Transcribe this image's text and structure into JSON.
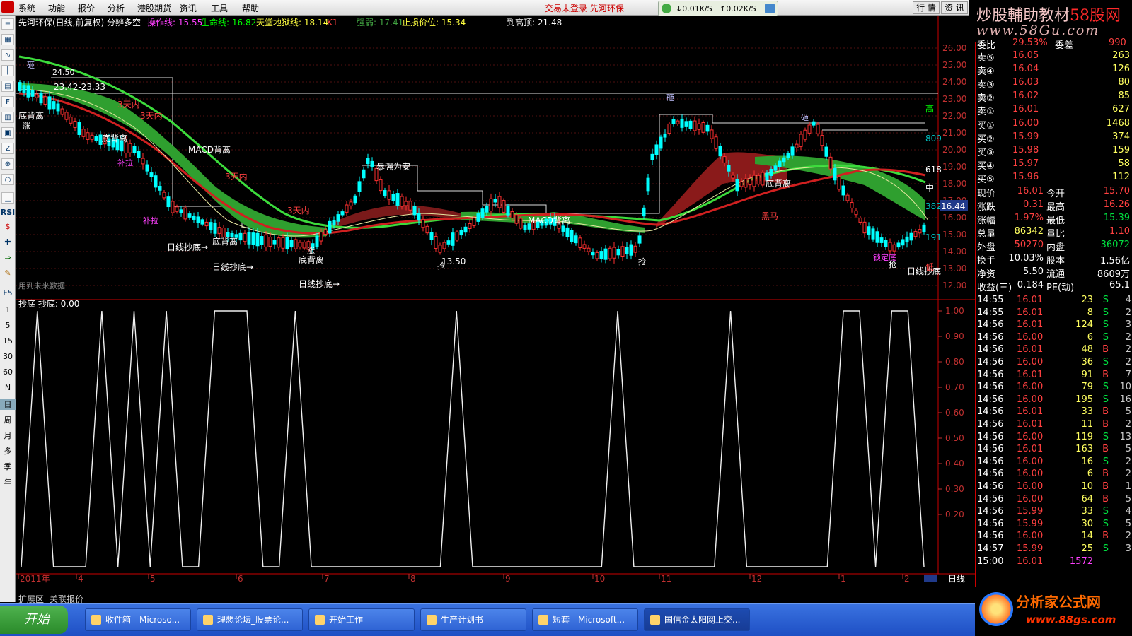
{
  "menu": [
    "系统",
    "功能",
    "报价",
    "分析",
    "港股期货",
    "资讯",
    "工具",
    "帮助"
  ],
  "status_msg": "交易未登录 先河环保",
  "net": {
    "down": "↓0.01K/S",
    "up": "↑0.02K/S"
  },
  "right_tabs": [
    "行 情",
    "资 讯"
  ],
  "brand": {
    "line1_a": "炒股輔助教材",
    "line1_b": "58股网",
    "line2": "www.58Gu.com"
  },
  "left_toolbar": {
    "icons": [
      "list-icon",
      "grid-icon",
      "line-icon",
      "kline-icon",
      "table-icon",
      "fio-icon",
      "chart-icon",
      "doc-icon",
      "fiz-icon",
      "zoom-icon",
      "search-icon",
      "bar-icon"
    ],
    "labels": [
      "RSI",
      "$",
      "✚",
      "⇒",
      "✎",
      "F5"
    ],
    "periods": [
      "1",
      "5",
      "15",
      "30",
      "60",
      "N",
      "日",
      "周",
      "月",
      "多",
      "季",
      "年"
    ]
  },
  "chart_header": {
    "title": "先河环保(日线,前复权) 分辨多空",
    "op_line": "操作线: 15.55",
    "life_line": "生命线: 16.82",
    "heaven_line": "天堂地狱线: 18.14",
    "k1": "K1 -",
    "strength": "强弱: 17.41",
    "stop_loss": "止损价位: 15.34",
    "to_top": "到高顶: 21.48"
  },
  "price_axis": [
    "26.00",
    "25.00",
    "24.00",
    "23.00",
    "22.00",
    "21.00",
    "20.00",
    "19.00",
    "18.00",
    "17.00",
    "16.00",
    "15.00",
    "14.00",
    "13.00",
    "12.00"
  ],
  "price_tags": {
    "current": "16.44",
    "high_mark": "高",
    "mid_mark": "中",
    "low_mark": "低",
    "r809": "809",
    "r618": "618",
    "r382": "382",
    "r191": "191"
  },
  "annotations": {
    "high_price": "24.50",
    "time_range": "23.42-23.33",
    "low_price": "13.50",
    "future_data": "用到未来数据",
    "bottom_div": "底背离",
    "macd_div": "MACD背离",
    "day_bottom": "日线抄底→",
    "within3": "3天内",
    "rise": "涨",
    "hammer": "砸",
    "wash": "补拉",
    "safe": "暴强为安",
    "black_horse": "黑马",
    "pick": "抢",
    "lock_bottom": "锁定底",
    "day_bottom2": "日线抄底"
  },
  "indicator": {
    "title": "抄底 抄底: 0.00",
    "axis": [
      "1.00",
      "0.90",
      "0.80",
      "0.70",
      "0.60",
      "0.50",
      "0.40",
      "0.30",
      "0.20"
    ]
  },
  "months": [
    "2011年",
    "4",
    "5",
    "6",
    "7",
    "8",
    "9",
    "10",
    "11",
    "12",
    "1",
    "2"
  ],
  "timeframe": "日线",
  "bottom_tabs": [
    "扩展区",
    "关联报价"
  ],
  "chart_data": {
    "type": "line",
    "series": [
      {
        "name": "抄底",
        "values": [
          0,
          1,
          0,
          0,
          0,
          1,
          0,
          1,
          0,
          1,
          0,
          0,
          1,
          1,
          1,
          0,
          0,
          1,
          0,
          0,
          0,
          0,
          0,
          0,
          0,
          0,
          0,
          1,
          0,
          0,
          0,
          0,
          0,
          0,
          0,
          0,
          0,
          1,
          0,
          0,
          0,
          0,
          0,
          0,
          1,
          0,
          0,
          0,
          0,
          0,
          0,
          1,
          1,
          0,
          1,
          1,
          0
        ]
      }
    ],
    "ylim": [
      0,
      1
    ]
  },
  "quote": {
    "header": {
      "l1": "委比",
      "v1": "29.53%",
      "l2": "委差",
      "v2": "990"
    },
    "asks": [
      {
        "label": "卖⑤",
        "price": "16.05",
        "vol": "263"
      },
      {
        "label": "卖④",
        "price": "16.04",
        "vol": "126"
      },
      {
        "label": "卖③",
        "price": "16.03",
        "vol": "80"
      },
      {
        "label": "卖②",
        "price": "16.02",
        "vol": "85"
      },
      {
        "label": "卖①",
        "price": "16.01",
        "vol": "627"
      }
    ],
    "bids": [
      {
        "label": "买①",
        "price": "16.00",
        "vol": "1468"
      },
      {
        "label": "买②",
        "price": "15.99",
        "vol": "374"
      },
      {
        "label": "买③",
        "price": "15.98",
        "vol": "159"
      },
      {
        "label": "买④",
        "price": "15.97",
        "vol": "58"
      },
      {
        "label": "买⑤",
        "price": "15.96",
        "vol": "112"
      }
    ],
    "stats": [
      {
        "l1": "现价",
        "v1": "16.01",
        "l2": "今开",
        "v2": "15.70",
        "c1": "#ff4040",
        "c2": "#ff4040"
      },
      {
        "l1": "涨跌",
        "v1": "0.31",
        "l2": "最高",
        "v2": "16.26",
        "c1": "#ff4040",
        "c2": "#ff4040"
      },
      {
        "l1": "涨幅",
        "v1": "1.97%",
        "l2": "最低",
        "v2": "15.39",
        "c1": "#ff4040",
        "c2": "#00e040"
      },
      {
        "l1": "总量",
        "v1": "86342",
        "l2": "量比",
        "v2": "1.10",
        "c1": "#ffff60",
        "c2": "#ff4040"
      },
      {
        "l1": "外盘",
        "v1": "50270",
        "l2": "内盘",
        "v2": "36072",
        "c1": "#ff4040",
        "c2": "#00e040"
      },
      {
        "l1": "换手",
        "v1": "10.03%",
        "l2": "股本",
        "v2": "1.56亿",
        "c1": "#ffffff",
        "c2": "#ffffff"
      },
      {
        "l1": "净资",
        "v1": "5.50",
        "l2": "流通",
        "v2": "8609万",
        "c1": "#ffffff",
        "c2": "#ffffff"
      },
      {
        "l1": "收益(三)",
        "v1": "0.184",
        "l2": "PE(动)",
        "v2": "65.1",
        "c1": "#ffffff",
        "c2": "#ffffff"
      }
    ],
    "ticks": [
      {
        "t": "14:55",
        "p": "16.01",
        "v": "23",
        "s": "S",
        "n": "4"
      },
      {
        "t": "14:55",
        "p": "16.01",
        "v": "8",
        "s": "S",
        "n": "2"
      },
      {
        "t": "14:56",
        "p": "16.01",
        "v": "124",
        "s": "S",
        "n": "3"
      },
      {
        "t": "14:56",
        "p": "16.00",
        "v": "6",
        "s": "S",
        "n": "2"
      },
      {
        "t": "14:56",
        "p": "16.01",
        "v": "48",
        "s": "B",
        "n": "2"
      },
      {
        "t": "14:56",
        "p": "16.00",
        "v": "36",
        "s": "S",
        "n": "2"
      },
      {
        "t": "14:56",
        "p": "16.01",
        "v": "91",
        "s": "B",
        "n": "7"
      },
      {
        "t": "14:56",
        "p": "16.00",
        "v": "79",
        "s": "S",
        "n": "10"
      },
      {
        "t": "14:56",
        "p": "16.00",
        "v": "195",
        "s": "S",
        "n": "16"
      },
      {
        "t": "14:56",
        "p": "16.01",
        "v": "33",
        "s": "B",
        "n": "5"
      },
      {
        "t": "14:56",
        "p": "16.01",
        "v": "11",
        "s": "B",
        "n": "2"
      },
      {
        "t": "14:56",
        "p": "16.00",
        "v": "119",
        "s": "S",
        "n": "13"
      },
      {
        "t": "14:56",
        "p": "16.01",
        "v": "163",
        "s": "B",
        "n": "5"
      },
      {
        "t": "14:56",
        "p": "16.00",
        "v": "16",
        "s": "S",
        "n": "2"
      },
      {
        "t": "14:56",
        "p": "16.00",
        "v": "6",
        "s": "B",
        "n": "2"
      },
      {
        "t": "14:56",
        "p": "16.00",
        "v": "10",
        "s": "B",
        "n": "1"
      },
      {
        "t": "14:56",
        "p": "16.00",
        "v": "64",
        "s": "B",
        "n": "5"
      },
      {
        "t": "14:56",
        "p": "15.99",
        "v": "33",
        "s": "S",
        "n": "4"
      },
      {
        "t": "14:56",
        "p": "15.99",
        "v": "30",
        "s": "S",
        "n": "5"
      },
      {
        "t": "14:56",
        "p": "16.00",
        "v": "14",
        "s": "B",
        "n": "2"
      },
      {
        "t": "14:57",
        "p": "15.99",
        "v": "25",
        "s": "S",
        "n": "3"
      },
      {
        "t": "15:00",
        "p": "16.01",
        "v": "1572",
        "s": "",
        "n": ""
      }
    ]
  },
  "taskbar": {
    "start": "开始",
    "tasks": [
      "收件箱 - Microso...",
      "理想论坛_股票论...",
      "开始工作",
      "生产计划书",
      "短套 - Microsoft...",
      "国信金太阳网上交..."
    ]
  },
  "tray_brand": {
    "a": "分析家公式网",
    "b": "www.88gs.com"
  }
}
